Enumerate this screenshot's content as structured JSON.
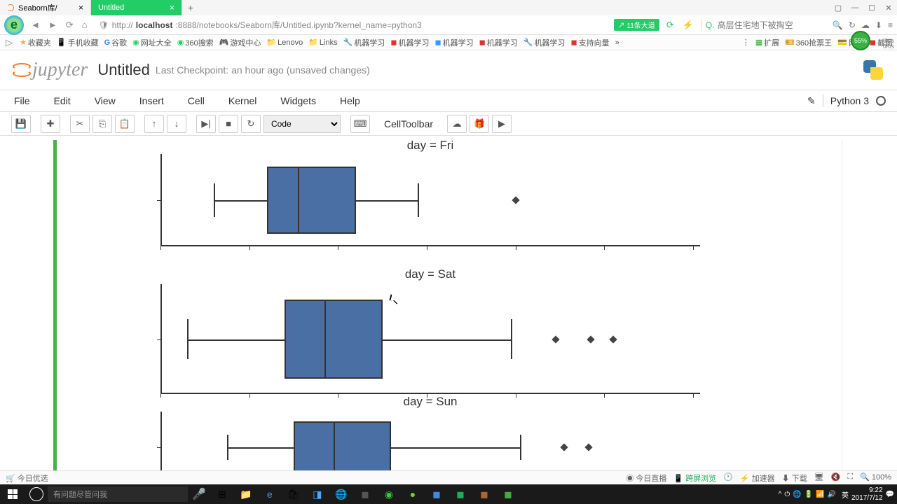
{
  "browser": {
    "tabs": [
      {
        "title": "Seaborn库/",
        "active": false
      },
      {
        "title": "Untitled",
        "active": true
      }
    ],
    "url_prefix": "http://",
    "url_host": "localhost",
    "url_path": ":8888/notebooks/Seaborn库/Untitled.ipynb?kernel_name=python3",
    "speed_badge": "↗ 11条大道",
    "search_placeholder": "高层住宅地下被掏空"
  },
  "bookmarks": {
    "items": [
      "收藏夹",
      "手机收藏",
      "谷歌",
      "网址大全",
      "360搜索",
      "游戏中心",
      "Lenovo",
      "Links",
      "机器学习",
      "机器学习",
      "机器学习",
      "机器学习",
      "机器学习",
      "支持向量"
    ],
    "right": [
      "扩展",
      "360抢票王",
      "网银",
      "截图"
    ]
  },
  "jupyter": {
    "logo": "jupyter",
    "title": "Untitled",
    "checkpoint": "Last Checkpoint: an hour ago (unsaved changes)",
    "menu": [
      "File",
      "Edit",
      "View",
      "Insert",
      "Cell",
      "Kernel",
      "Widgets",
      "Help"
    ],
    "kernel": "Python 3",
    "cell_type": "Code",
    "celltoolbar": "CellToolbar"
  },
  "status": {
    "left": "今日优选",
    "right": [
      "今日直播",
      "跨屏浏览",
      "加速器",
      "下载",
      "100%"
    ]
  },
  "taskbar": {
    "search": "有问题尽管问我",
    "time": "9:22",
    "date": "2017/7/12"
  },
  "chart_data": [
    {
      "type": "boxplot",
      "title": "day = Fri",
      "x_range": [
        0,
        60
      ],
      "q1": 12,
      "median": 15.5,
      "q3": 22,
      "whisker_low": 6,
      "whisker_high": 29,
      "outliers": [
        40
      ]
    },
    {
      "type": "boxplot",
      "title": "day = Sat",
      "x_range": [
        0,
        60
      ],
      "q1": 14,
      "median": 18.5,
      "q3": 25,
      "whisker_low": 3,
      "whisker_high": 39.5,
      "outliers": [
        44.5,
        48.5,
        51
      ]
    },
    {
      "type": "boxplot",
      "title": "day = Sun",
      "x_range": [
        0,
        60
      ],
      "q1": 15,
      "median": 19.5,
      "q3": 26,
      "whisker_low": 7.5,
      "whisker_high": 40.5,
      "outliers": [
        45.5,
        48.2
      ]
    }
  ]
}
